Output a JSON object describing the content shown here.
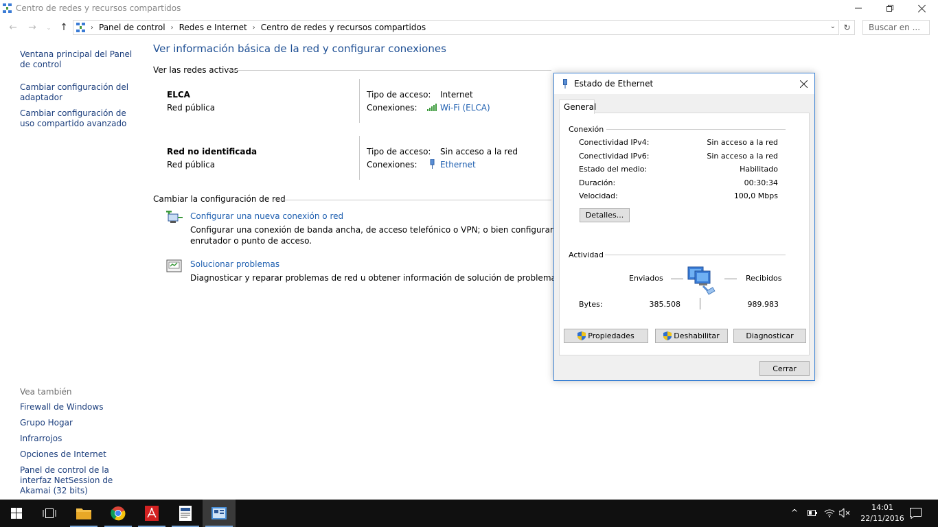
{
  "window": {
    "title": "Centro de redes y recursos compartidos"
  },
  "breadcrumb": {
    "items": [
      "Panel de control",
      "Redes e Internet",
      "Centro de redes y recursos compartidos"
    ]
  },
  "search": {
    "placeholder": "Buscar en ..."
  },
  "sidebar": {
    "links": [
      "Ventana principal del Panel de control",
      "Cambiar configuración del adaptador",
      "Cambiar configuración de uso compartido avanzado"
    ],
    "see_also_title": "Vea también",
    "see_also": [
      "Firewall de Windows",
      "Grupo Hogar",
      "Infrarrojos",
      "Opciones de Internet",
      "Panel de control de la interfaz NetSession de Akamai (32 bits)"
    ]
  },
  "main": {
    "heading": "Ver información básica de la red y configurar conexiones",
    "active_networks_title": "Ver las redes activas",
    "networks": [
      {
        "name": "ELCA",
        "type": "Red pública",
        "access_label": "Tipo de acceso:",
        "access_value": "Internet",
        "connections_label": "Conexiones:",
        "connection": "Wi-Fi (ELCA)"
      },
      {
        "name": "Red no identificada",
        "type": "Red pública",
        "access_label": "Tipo de acceso:",
        "access_value": "Sin acceso a la red",
        "connections_label": "Conexiones:",
        "connection": "Ethernet"
      }
    ],
    "change_title": "Cambiar la configuración de red",
    "tasks": [
      {
        "link": "Configurar una nueva conexión o red",
        "desc_line1": "Configurar una conexión de banda ancha, de acceso telefónico o VPN; o bien configurar un",
        "desc_line2": "enrutador o punto de acceso."
      },
      {
        "link": "Solucionar problemas",
        "desc_line1": "Diagnosticar y reparar problemas de red u obtener información de solución de problemas."
      }
    ]
  },
  "dialog": {
    "title": "Estado de Ethernet",
    "tab": "General",
    "connection_title": "Conexión",
    "rows": [
      {
        "label": "Conectividad IPv4:",
        "value": "Sin acceso a la red"
      },
      {
        "label": "Conectividad IPv6:",
        "value": "Sin acceso a la red"
      },
      {
        "label": "Estado del medio:",
        "value": "Habilitado"
      },
      {
        "label": "Duración:",
        "value": "00:30:34"
      },
      {
        "label": "Velocidad:",
        "value": "100,0 Mbps"
      }
    ],
    "details_button": "Detalles...",
    "activity_title": "Actividad",
    "sent_label": "Enviados",
    "received_label": "Recibidos",
    "bytes_label": "Bytes:",
    "bytes_sent": "385.508",
    "bytes_received": "989.983",
    "properties_button": "Propiedades",
    "disable_button": "Deshabilitar",
    "diagnose_button": "Diagnosticar",
    "close_button": "Cerrar"
  },
  "taskbar": {
    "time": "14:01",
    "date": "22/11/2016"
  }
}
